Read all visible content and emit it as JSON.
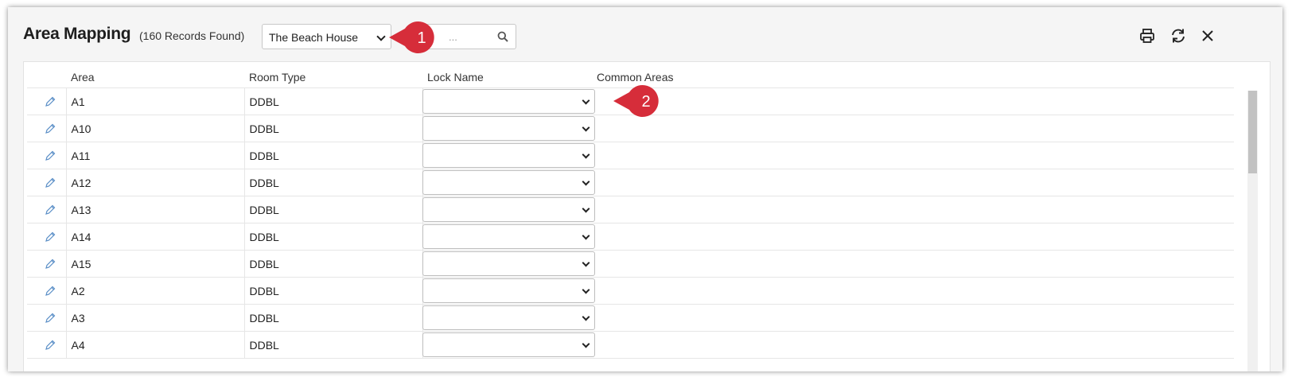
{
  "header": {
    "title": "Area Mapping",
    "record_count": "(160 Records Found)",
    "property_select": {
      "selected": "The Beach House"
    },
    "search": {
      "placeholder": "..."
    }
  },
  "toolbar": {
    "print_icon": "printer-icon",
    "refresh_icon": "refresh-icon",
    "close_icon": "close-icon"
  },
  "table": {
    "columns": [
      "Area",
      "Room Type",
      "Lock Name",
      "Common Areas"
    ],
    "rows": [
      {
        "area": "A1",
        "room_type": "DDBL",
        "lock_name": "",
        "common_areas": ""
      },
      {
        "area": "A10",
        "room_type": "DDBL",
        "lock_name": "",
        "common_areas": ""
      },
      {
        "area": "A11",
        "room_type": "DDBL",
        "lock_name": "",
        "common_areas": ""
      },
      {
        "area": "A12",
        "room_type": "DDBL",
        "lock_name": "",
        "common_areas": ""
      },
      {
        "area": "A13",
        "room_type": "DDBL",
        "lock_name": "",
        "common_areas": ""
      },
      {
        "area": "A14",
        "room_type": "DDBL",
        "lock_name": "",
        "common_areas": ""
      },
      {
        "area": "A15",
        "room_type": "DDBL",
        "lock_name": "",
        "common_areas": ""
      },
      {
        "area": "A2",
        "room_type": "DDBL",
        "lock_name": "",
        "common_areas": ""
      },
      {
        "area": "A3",
        "room_type": "DDBL",
        "lock_name": "",
        "common_areas": ""
      },
      {
        "area": "A4",
        "room_type": "DDBL",
        "lock_name": "",
        "common_areas": ""
      }
    ]
  },
  "annotations": [
    {
      "label": "1",
      "color": "#d62d3a"
    },
    {
      "label": "2",
      "color": "#d62d3a"
    }
  ],
  "colors": {
    "edit_icon": "#5b8fc7",
    "marker": "#d62d3a"
  }
}
